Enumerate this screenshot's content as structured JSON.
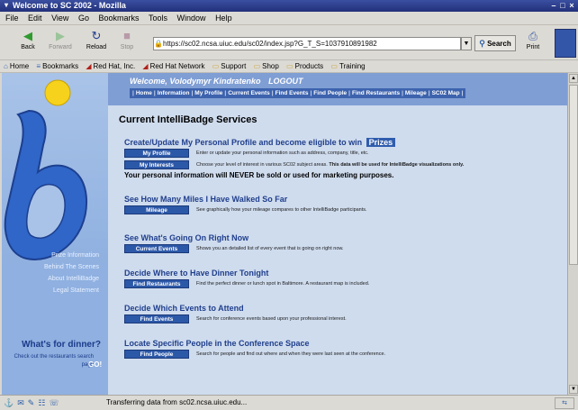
{
  "window": {
    "title": "Welcome to SC 2002 - Mozilla",
    "buttons": [
      "–",
      "□",
      "×"
    ]
  },
  "menu": [
    "File",
    "Edit",
    "View",
    "Go",
    "Bookmarks",
    "Tools",
    "Window",
    "Help"
  ],
  "nav": {
    "back": "Back",
    "forward": "Forward",
    "reload": "Reload",
    "stop": "Stop",
    "url": "https://sc02.ncsa.uiuc.edu/sc02/index.jsp?G_T_S=1037910891982",
    "search": "Search",
    "print": "Print"
  },
  "personal_toolbar": [
    "Home",
    "Bookmarks",
    "Red Hat, Inc.",
    "Red Hat Network",
    "Support",
    "Shop",
    "Products",
    "Training"
  ],
  "header": {
    "welcome": "Welcome, Volodymyr Kindratenko",
    "logout": "LOGOUT",
    "nav_links": [
      "Home",
      "Information",
      "My Profile",
      "Current Events",
      "Find Events",
      "Find People",
      "Find Restaurants",
      "Mileage",
      "SC02 Map"
    ]
  },
  "sidebar": {
    "links": [
      "Prize Information",
      "Behind The Scenes",
      "About IntelliBadge",
      "Legal Statement"
    ],
    "dinner": {
      "title": "What's for dinner?",
      "text": "Check out the restaurants search page",
      "go": "GO!"
    }
  },
  "main": {
    "title": "Current IntelliBadge Services",
    "sections": [
      {
        "heading": "Create/Update My Personal Profile and become eligible to win",
        "badge": "Prizes",
        "rows": [
          {
            "button": "My Profile",
            "text": "Enter or update your personal information such as address, company, title, etc."
          },
          {
            "button": "My Interests",
            "text": "Choose your level of interest in various SC02 subject areas.",
            "bold": "This data will be used for IntelliBadge visualizations only."
          }
        ],
        "note": "Your personal information will NEVER be sold or used for marketing purposes."
      },
      {
        "heading": "See How Many Miles I Have Walked So Far",
        "rows": [
          {
            "button": "Mileage",
            "text": "See graphically how your mileage compares to other IntelliBadge participants."
          }
        ]
      },
      {
        "heading": "See What's Going On Right Now",
        "rows": [
          {
            "button": "Current Events",
            "text": "Shows you an detailed list of every event that is going on right now."
          }
        ]
      },
      {
        "heading": "Decide Where to Have Dinner Tonight",
        "rows": [
          {
            "button": "Find Restaurants",
            "text": "Find the perfect dinner or lunch spot in Baltimore. A restaurant map is included."
          }
        ]
      },
      {
        "heading": "Decide Which Events to Attend",
        "rows": [
          {
            "button": "Find Events",
            "text": "Search for conference events based upon your professional interest."
          }
        ]
      },
      {
        "heading": "Locate Specific People in the Conference Space",
        "rows": [
          {
            "button": "Find People",
            "text": "Search for people and find out where and when they were last seen at the conference."
          }
        ]
      }
    ]
  },
  "status": {
    "text": "Transferring data from sc02.ncsa.uiuc.edu..."
  },
  "colors": {
    "page_bg": "#cfdcee",
    "header_band": "#7f9ed4",
    "button_bg": "#2c58a8",
    "heading": "#203f8c"
  }
}
